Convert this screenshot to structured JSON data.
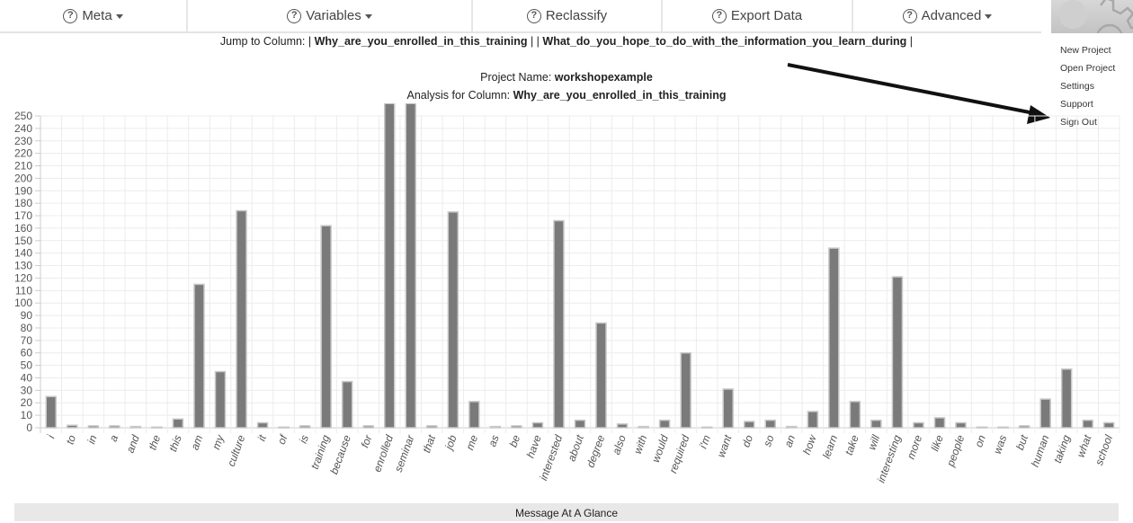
{
  "navbar": {
    "items": [
      {
        "label": "Meta",
        "icon": "question-circle-icon",
        "dropdown": true
      },
      {
        "label": "Variables",
        "icon": "question-circle-icon",
        "dropdown": true
      },
      {
        "label": "Reclassify",
        "icon": "question-circle-icon",
        "dropdown": false
      },
      {
        "label": "Export Data",
        "icon": "question-circle-icon",
        "dropdown": false
      },
      {
        "label": "Advanced",
        "icon": "question-circle-icon",
        "dropdown": true
      }
    ],
    "settings_icon": "gear-icon"
  },
  "user_menu": {
    "items": [
      "New Project",
      "Open Project",
      "Settings",
      "Support",
      "Sign Out"
    ]
  },
  "jump": {
    "prefix": "Jump to Column: | ",
    "columns": [
      "Why_are_you_enrolled_in_this_training",
      "What_do_you_hope_to_do_with_the_information_you_learn_during"
    ],
    "separator": " | | ",
    "suffix": " |"
  },
  "project": {
    "label": "Project Name: ",
    "name": "workshopexample"
  },
  "analysis": {
    "label": "Analysis for Column: ",
    "column": "Why_are_you_enrolled_in_this_training"
  },
  "chart_data": {
    "type": "bar",
    "title": "",
    "xlabel": "",
    "ylabel": "",
    "ylim": [
      0,
      250
    ],
    "ytick_step": 10,
    "grid": true,
    "bar_color": "#7a7a7a",
    "categories": [
      "i",
      "to",
      "in",
      "a",
      "and",
      "the",
      "this",
      "am",
      "my",
      "culture",
      "it",
      "of",
      "is",
      "training",
      "because",
      "for",
      "enrolled",
      "seminar",
      "that",
      "job",
      "me",
      "as",
      "be",
      "have",
      "interested",
      "about",
      "degree",
      "also",
      "with",
      "would",
      "required",
      "i'm",
      "want",
      "do",
      "so",
      "an",
      "how",
      "learn",
      "take",
      "will",
      "interesting",
      "more",
      "like",
      "people",
      "on",
      "was",
      "but",
      "human",
      "taking",
      "what",
      "school"
    ],
    "values": [
      25,
      2,
      1.5,
      1.5,
      1,
      0.5,
      7,
      115,
      45,
      174,
      4,
      0.5,
      1.5,
      162,
      37,
      1.5,
      260,
      260,
      1.5,
      173,
      21,
      1,
      1.5,
      4,
      166,
      6,
      84,
      3,
      1,
      6,
      60,
      0.5,
      31,
      5,
      6,
      1,
      13,
      144,
      21,
      6,
      121,
      4,
      8,
      4,
      0.5,
      0.5,
      1.5,
      23,
      47,
      6,
      4
    ]
  },
  "footer": {
    "label": "Message At A Glance"
  }
}
